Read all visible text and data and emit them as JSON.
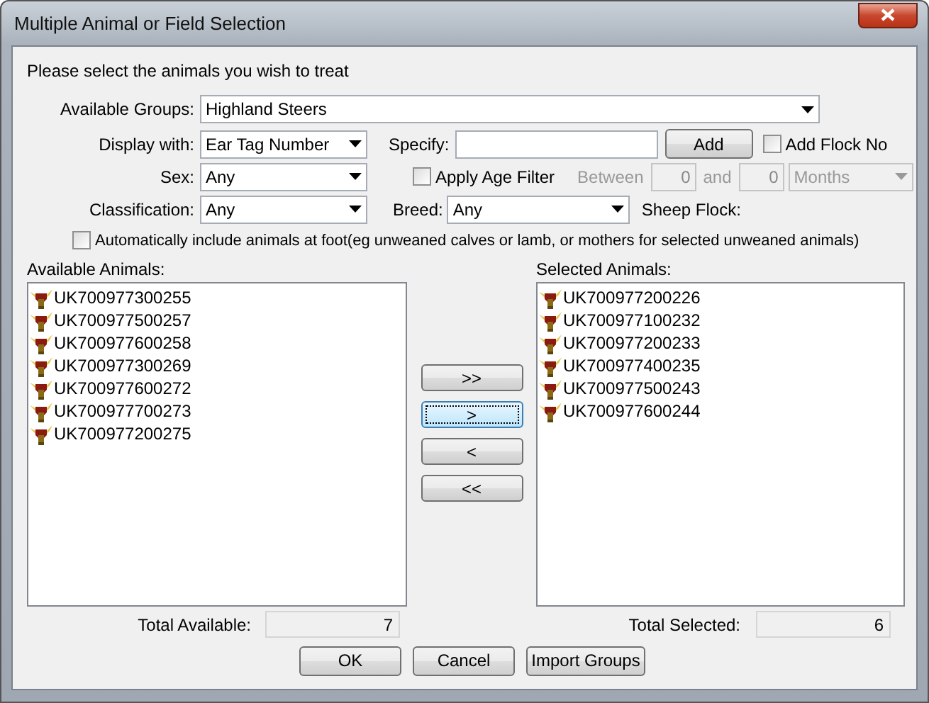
{
  "window": {
    "title": "Multiple Animal or Field Selection"
  },
  "instruction": "Please select the animals you wish to treat",
  "available_groups": {
    "label": "Available Groups:",
    "value": "Highland Steers"
  },
  "display_with": {
    "label": "Display with:",
    "value": "Ear Tag Number"
  },
  "specify": {
    "label": "Specify:",
    "button": "Add"
  },
  "add_flock_no": {
    "label": "Add Flock No",
    "checked": false
  },
  "sex": {
    "label": "Sex:",
    "value": "Any"
  },
  "age_filter": {
    "label": "Apply Age Filter",
    "checked": false,
    "between_label": "Between",
    "from": "0",
    "and_label": "and",
    "to": "0",
    "unit": "Months"
  },
  "classification": {
    "label": "Classification:",
    "value": "Any"
  },
  "breed": {
    "label": "Breed:",
    "value": "Any"
  },
  "sheep_flock": {
    "label": "Sheep Flock:"
  },
  "auto_include": {
    "label": "Automatically include animals at foot(eg unweaned calves or lamb, or mothers for selected unweaned animals)",
    "checked": false
  },
  "available_animals": {
    "label": "Available Animals:",
    "total_label": "Total Available:",
    "total": "7",
    "items": [
      {
        "tag": "UK700977300255"
      },
      {
        "tag": "UK700977500257"
      },
      {
        "tag": "UK700977600258"
      },
      {
        "tag": "UK700977300269"
      },
      {
        "tag": "UK700977600272"
      },
      {
        "tag": "UK700977700273"
      },
      {
        "tag": "UK700977200275"
      }
    ]
  },
  "selected_animals": {
    "label": "Selected Animals:",
    "total_label": "Total Selected:",
    "total": "6",
    "items": [
      {
        "tag": "UK700977200226"
      },
      {
        "tag": "UK700977100232"
      },
      {
        "tag": "UK700977200233"
      },
      {
        "tag": "UK700977400235"
      },
      {
        "tag": "UK700977500243"
      },
      {
        "tag": "UK700977600244"
      }
    ]
  },
  "transfer_buttons": [
    {
      "label": ">>",
      "focused": false
    },
    {
      "label": ">",
      "focused": true
    },
    {
      "label": "<",
      "focused": false
    },
    {
      "label": "<<",
      "focused": false
    }
  ],
  "buttons": [
    "OK",
    "Cancel",
    "Import Groups"
  ]
}
